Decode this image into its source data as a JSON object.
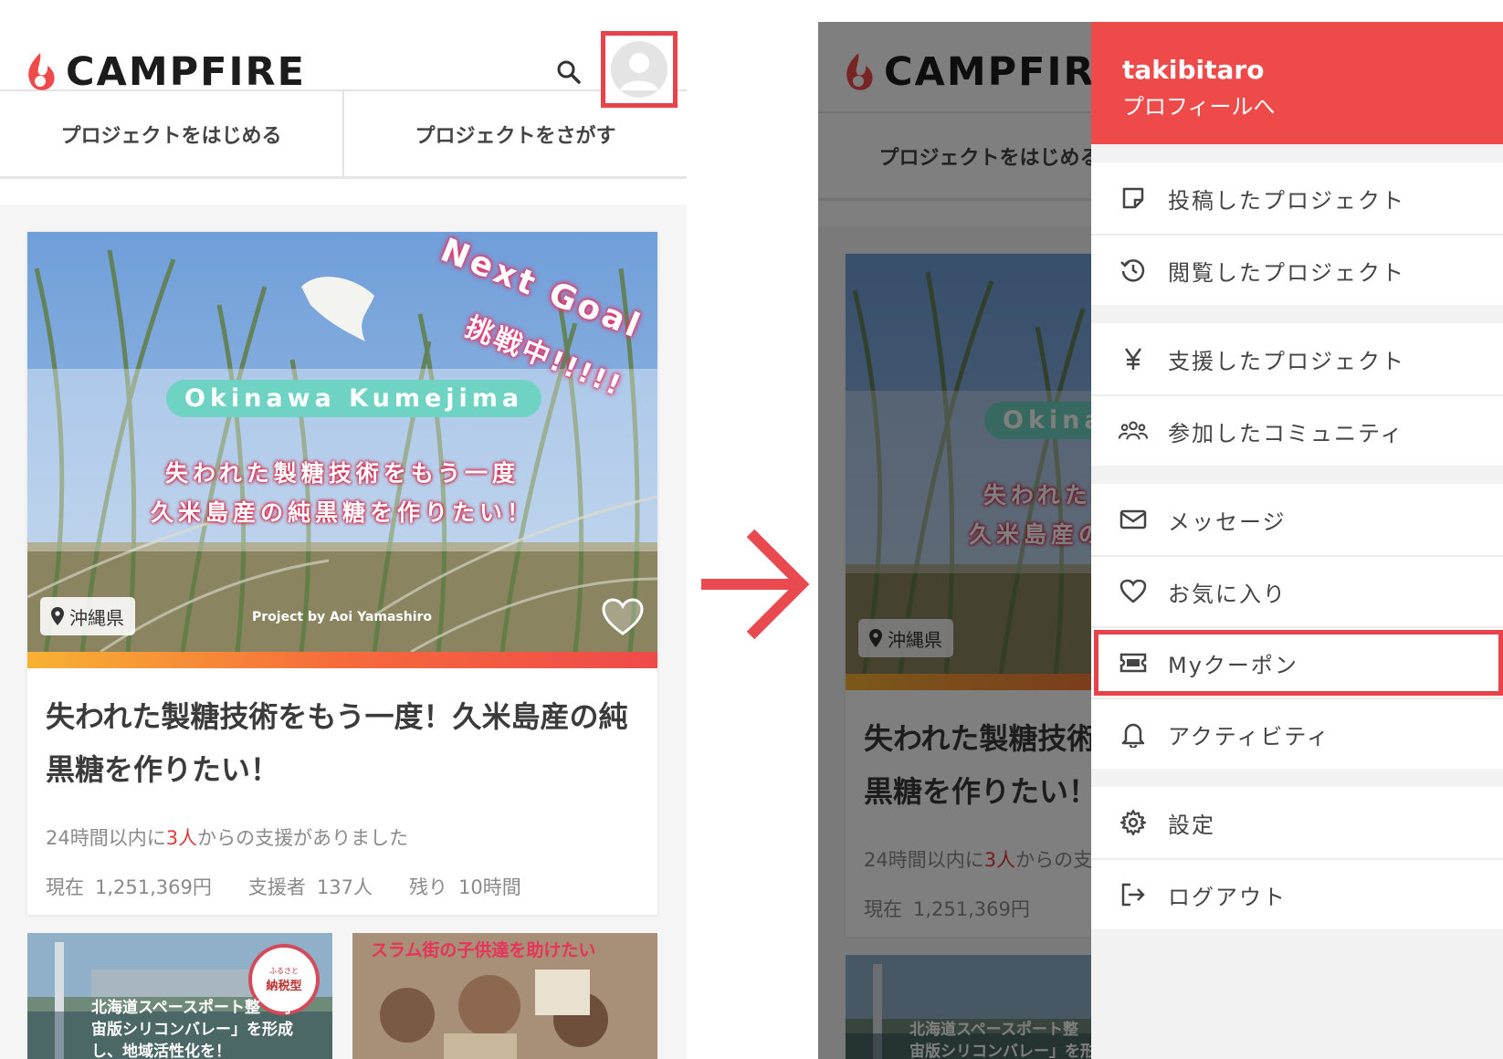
{
  "header": {
    "logo_text": "CAMPFIRE",
    "search_icon": "search-icon",
    "avatar_icon": "avatar-icon"
  },
  "tabs": [
    {
      "label": "プロジェクトをはじめる"
    },
    {
      "label": "プロジェクトをさがす"
    }
  ],
  "project": {
    "image": {
      "next_goal": "Next Goal",
      "challenge": "挑戦中!!!!!",
      "sign": "Okinawa Kumejima",
      "line1": "失われた製糖技術をもう一度",
      "line2": "久米島産の純黒糖を作りたい！"
    },
    "location": "沖縄県",
    "credit": "Project by Aoi Yamashiro",
    "title": "失われた製糖技術をもう一度！久米島産の純黒糖を作りたい！",
    "recent_prefix": "24時間以内に",
    "recent_count": "3人",
    "recent_suffix": "からの支援がありました",
    "stats": [
      {
        "label": "現在",
        "value": "1,251,369円"
      },
      {
        "label": "支援者",
        "value": "137人"
      },
      {
        "label": "残り",
        "value": "10時間"
      }
    ]
  },
  "mini_cards": [
    {
      "seal_small": "ふるさと",
      "seal_main": "納税型",
      "caption": "北海道スペースポート整 「宇宙版シリコンバレー」を形成 し、地域活性化を！"
    },
    {
      "caption": "スラム街の子供達を助けたい"
    }
  ],
  "drawer": {
    "username": "takibitaro",
    "profile_link": "プロフィールへ",
    "groups": [
      [
        {
          "label": "投稿したプロジェクト",
          "icon": "post-icon"
        },
        {
          "label": "閲覧したプロジェクト",
          "icon": "history-icon"
        }
      ],
      [
        {
          "label": "支援したプロジェクト",
          "icon": "yen-icon"
        },
        {
          "label": "参加したコミュニティ",
          "icon": "community-icon"
        }
      ],
      [
        {
          "label": "メッセージ",
          "icon": "mail-icon"
        },
        {
          "label": "お気に入り",
          "icon": "heart-icon"
        },
        {
          "label": "Myクーポン",
          "icon": "coupon-icon"
        },
        {
          "label": "アクティビティ",
          "icon": "bell-icon"
        }
      ],
      [
        {
          "label": "設定",
          "icon": "gear-icon"
        },
        {
          "label": "ログアウト",
          "icon": "logout-icon"
        }
      ]
    ]
  },
  "colors": {
    "brand_red": "#ef4a4a",
    "highlight": "#e8434a",
    "arrow": "#e84a4f"
  }
}
